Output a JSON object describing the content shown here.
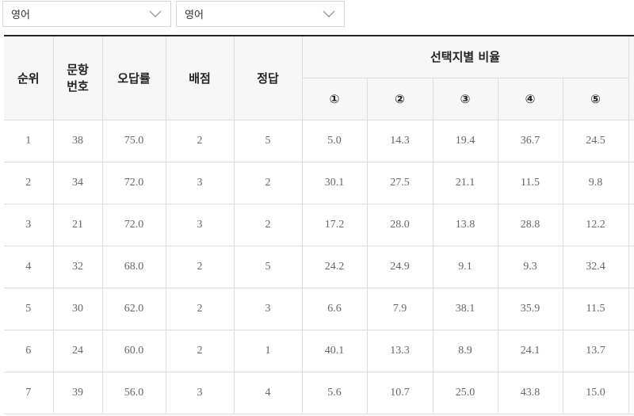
{
  "filters": [
    {
      "value": "영어"
    },
    {
      "value": "영어"
    }
  ],
  "table": {
    "headers": {
      "rank": "순위",
      "question_line1": "문항",
      "question_line2": "번호",
      "error_rate": "오답률",
      "points": "배점",
      "answer": "정답",
      "choice_group": "선택지별 비율",
      "choices": [
        "①",
        "②",
        "③",
        "④",
        "⑤"
      ]
    },
    "rows": [
      {
        "rank": "1",
        "question": "38",
        "error_rate": "75.0",
        "points": "2",
        "answer": "5",
        "choices": [
          "5.0",
          "14.3",
          "19.4",
          "36.7",
          "24.5"
        ]
      },
      {
        "rank": "2",
        "question": "34",
        "error_rate": "72.0",
        "points": "3",
        "answer": "2",
        "choices": [
          "30.1",
          "27.5",
          "21.1",
          "11.5",
          "9.8"
        ]
      },
      {
        "rank": "3",
        "question": "21",
        "error_rate": "72.0",
        "points": "3",
        "answer": "2",
        "choices": [
          "17.2",
          "28.0",
          "13.8",
          "28.8",
          "12.2"
        ]
      },
      {
        "rank": "4",
        "question": "32",
        "error_rate": "68.0",
        "points": "2",
        "answer": "5",
        "choices": [
          "24.2",
          "24.9",
          "9.1",
          "9.3",
          "32.4"
        ]
      },
      {
        "rank": "5",
        "question": "30",
        "error_rate": "62.0",
        "points": "2",
        "answer": "3",
        "choices": [
          "6.6",
          "7.9",
          "38.1",
          "35.9",
          "11.5"
        ]
      },
      {
        "rank": "6",
        "question": "24",
        "error_rate": "60.0",
        "points": "2",
        "answer": "1",
        "choices": [
          "40.1",
          "13.3",
          "8.9",
          "24.1",
          "13.7"
        ]
      },
      {
        "rank": "7",
        "question": "39",
        "error_rate": "56.0",
        "points": "3",
        "answer": "4",
        "choices": [
          "5.6",
          "10.7",
          "25.0",
          "43.8",
          "15.0"
        ]
      }
    ]
  }
}
